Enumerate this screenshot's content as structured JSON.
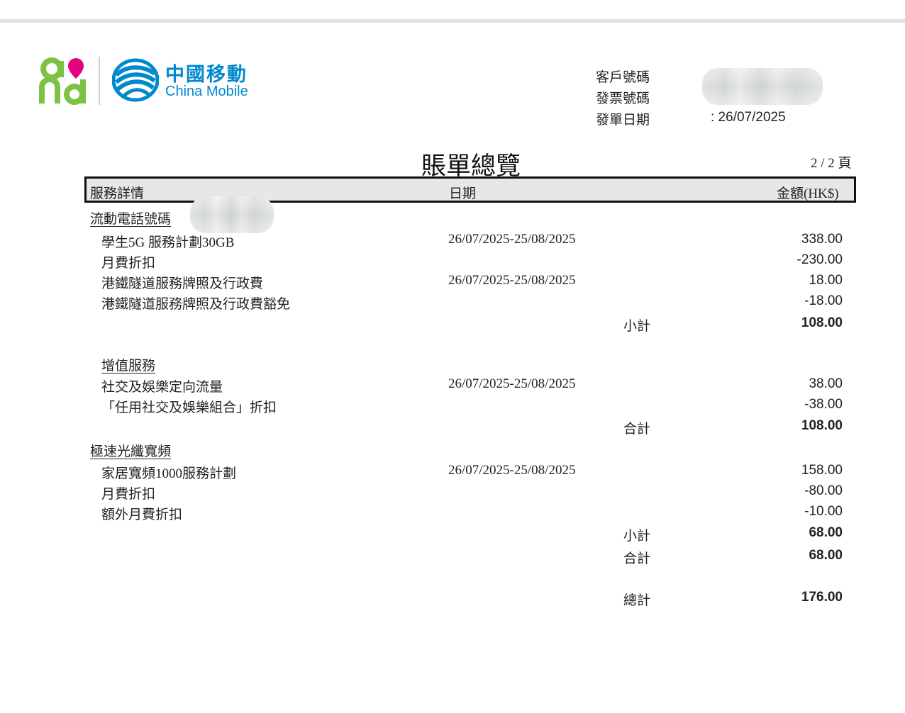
{
  "brand": {
    "logo_and": "and",
    "cn_name": "中國移動",
    "en_name": "China Mobile",
    "colors": {
      "and_green": "#7dc242",
      "and_pink": "#e6007e",
      "cmcc_blue": "#0089cf"
    }
  },
  "info": {
    "customer_no_label": "客戶號碼",
    "invoice_no_label": "發票號碼",
    "bill_date_label": "發單日期",
    "bill_date_value": ": 26/07/2025"
  },
  "title": "賬單總覽",
  "page": "2 / 2 頁",
  "table_header": {
    "col_service": "服務詳情",
    "col_date": "日期",
    "col_amount": "金額(HK$)"
  },
  "sections": {
    "mobile": {
      "title": "流動電話號碼",
      "items": [
        {
          "name": "學生5G 服務計劃30GB",
          "date": "26/07/2025-25/08/2025",
          "amount": "338.00"
        },
        {
          "name": "月費折扣",
          "date": "",
          "amount": "-230.00"
        },
        {
          "name": "港鐵隧道服務牌照及行政費",
          "date": "26/07/2025-25/08/2025",
          "amount": "18.00"
        },
        {
          "name": "港鐵隧道服務牌照及行政費豁免",
          "date": "",
          "amount": "-18.00"
        }
      ],
      "subtotal_label": "小計",
      "subtotal": "108.00"
    },
    "vas": {
      "title": "增值服務",
      "items": [
        {
          "name": "社交及娛樂定向流量",
          "date": "26/07/2025-25/08/2025",
          "amount": "38.00"
        },
        {
          "name": "「任用社交及娛樂組合」折扣",
          "date": "",
          "amount": "-38.00"
        }
      ],
      "total_label": "合計",
      "total": "108.00"
    },
    "broadband": {
      "title": "極速光纖寬頻",
      "items": [
        {
          "name": "家居寬頻1000服務計劃",
          "date": "26/07/2025-25/08/2025",
          "amount": "158.00"
        },
        {
          "name": "月費折扣",
          "date": "",
          "amount": "-80.00"
        },
        {
          "name": "額外月費折扣",
          "date": "",
          "amount": "-10.00"
        }
      ],
      "subtotal_label": "小計",
      "subtotal": "68.00",
      "total_label": "合計",
      "total": "68.00"
    }
  },
  "grand_total_label": "總計",
  "grand_total": "176.00"
}
